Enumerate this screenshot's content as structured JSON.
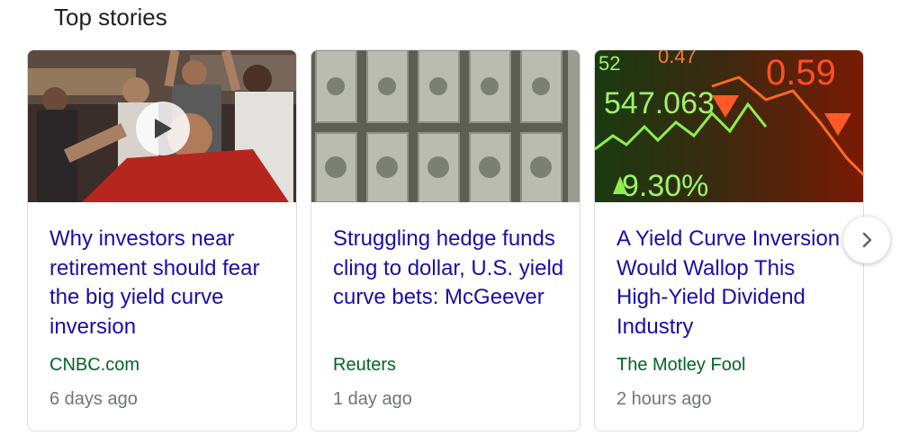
{
  "section": {
    "title": "Top stories"
  },
  "stories": [
    {
      "headline": "Why investors near retirement should fear the big yield curve inversion",
      "source": "CNBC.com",
      "age": "6 days ago",
      "image": "trading-floor-photo",
      "has_video": true
    },
    {
      "headline": "Struggling hedge funds cling to dollar, U.S. yield curve bets: McGeever",
      "source": "Reuters",
      "age": "1 day ago",
      "image": "dollar-bills-photo",
      "has_video": false
    },
    {
      "headline": "A Yield Curve Inversion Would Wallop This High-Yield Dividend Industry",
      "source": "The Motley Fool",
      "age": "2 hours ago",
      "image": "stock-ticker-photo",
      "has_video": false,
      "image_text": {
        "main": "547.063",
        "top_left": "52",
        "top": "0.47",
        "right": "0.59",
        "bottom": "9.30%"
      }
    }
  ],
  "carousel": {
    "next_icon": "chevron-right-icon"
  },
  "colors": {
    "headline": "#1a0dab",
    "source": "#006621",
    "meta": "#70757a",
    "border": "#dadce0"
  }
}
